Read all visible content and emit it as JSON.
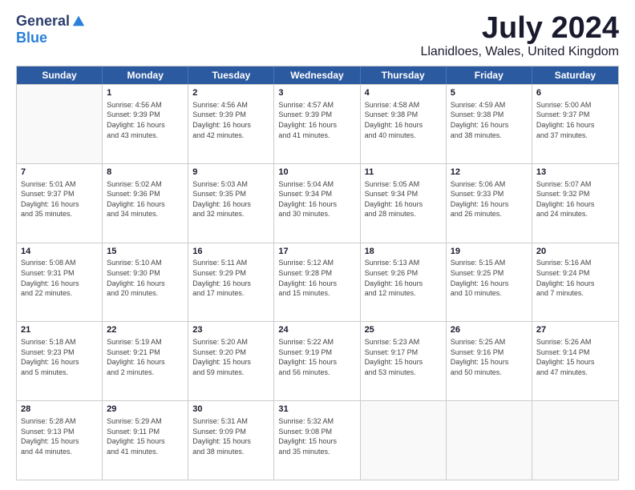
{
  "header": {
    "logo_general": "General",
    "logo_blue": "Blue",
    "month": "July 2024",
    "location": "Llanidloes, Wales, United Kingdom"
  },
  "days_of_week": [
    "Sunday",
    "Monday",
    "Tuesday",
    "Wednesday",
    "Thursday",
    "Friday",
    "Saturday"
  ],
  "rows": [
    [
      {
        "day": "",
        "info": ""
      },
      {
        "day": "1",
        "info": "Sunrise: 4:56 AM\nSunset: 9:39 PM\nDaylight: 16 hours\nand 43 minutes."
      },
      {
        "day": "2",
        "info": "Sunrise: 4:56 AM\nSunset: 9:39 PM\nDaylight: 16 hours\nand 42 minutes."
      },
      {
        "day": "3",
        "info": "Sunrise: 4:57 AM\nSunset: 9:39 PM\nDaylight: 16 hours\nand 41 minutes."
      },
      {
        "day": "4",
        "info": "Sunrise: 4:58 AM\nSunset: 9:38 PM\nDaylight: 16 hours\nand 40 minutes."
      },
      {
        "day": "5",
        "info": "Sunrise: 4:59 AM\nSunset: 9:38 PM\nDaylight: 16 hours\nand 38 minutes."
      },
      {
        "day": "6",
        "info": "Sunrise: 5:00 AM\nSunset: 9:37 PM\nDaylight: 16 hours\nand 37 minutes."
      }
    ],
    [
      {
        "day": "7",
        "info": "Sunrise: 5:01 AM\nSunset: 9:37 PM\nDaylight: 16 hours\nand 35 minutes."
      },
      {
        "day": "8",
        "info": "Sunrise: 5:02 AM\nSunset: 9:36 PM\nDaylight: 16 hours\nand 34 minutes."
      },
      {
        "day": "9",
        "info": "Sunrise: 5:03 AM\nSunset: 9:35 PM\nDaylight: 16 hours\nand 32 minutes."
      },
      {
        "day": "10",
        "info": "Sunrise: 5:04 AM\nSunset: 9:34 PM\nDaylight: 16 hours\nand 30 minutes."
      },
      {
        "day": "11",
        "info": "Sunrise: 5:05 AM\nSunset: 9:34 PM\nDaylight: 16 hours\nand 28 minutes."
      },
      {
        "day": "12",
        "info": "Sunrise: 5:06 AM\nSunset: 9:33 PM\nDaylight: 16 hours\nand 26 minutes."
      },
      {
        "day": "13",
        "info": "Sunrise: 5:07 AM\nSunset: 9:32 PM\nDaylight: 16 hours\nand 24 minutes."
      }
    ],
    [
      {
        "day": "14",
        "info": "Sunrise: 5:08 AM\nSunset: 9:31 PM\nDaylight: 16 hours\nand 22 minutes."
      },
      {
        "day": "15",
        "info": "Sunrise: 5:10 AM\nSunset: 9:30 PM\nDaylight: 16 hours\nand 20 minutes."
      },
      {
        "day": "16",
        "info": "Sunrise: 5:11 AM\nSunset: 9:29 PM\nDaylight: 16 hours\nand 17 minutes."
      },
      {
        "day": "17",
        "info": "Sunrise: 5:12 AM\nSunset: 9:28 PM\nDaylight: 16 hours\nand 15 minutes."
      },
      {
        "day": "18",
        "info": "Sunrise: 5:13 AM\nSunset: 9:26 PM\nDaylight: 16 hours\nand 12 minutes."
      },
      {
        "day": "19",
        "info": "Sunrise: 5:15 AM\nSunset: 9:25 PM\nDaylight: 16 hours\nand 10 minutes."
      },
      {
        "day": "20",
        "info": "Sunrise: 5:16 AM\nSunset: 9:24 PM\nDaylight: 16 hours\nand 7 minutes."
      }
    ],
    [
      {
        "day": "21",
        "info": "Sunrise: 5:18 AM\nSunset: 9:23 PM\nDaylight: 16 hours\nand 5 minutes."
      },
      {
        "day": "22",
        "info": "Sunrise: 5:19 AM\nSunset: 9:21 PM\nDaylight: 16 hours\nand 2 minutes."
      },
      {
        "day": "23",
        "info": "Sunrise: 5:20 AM\nSunset: 9:20 PM\nDaylight: 15 hours\nand 59 minutes."
      },
      {
        "day": "24",
        "info": "Sunrise: 5:22 AM\nSunset: 9:19 PM\nDaylight: 15 hours\nand 56 minutes."
      },
      {
        "day": "25",
        "info": "Sunrise: 5:23 AM\nSunset: 9:17 PM\nDaylight: 15 hours\nand 53 minutes."
      },
      {
        "day": "26",
        "info": "Sunrise: 5:25 AM\nSunset: 9:16 PM\nDaylight: 15 hours\nand 50 minutes."
      },
      {
        "day": "27",
        "info": "Sunrise: 5:26 AM\nSunset: 9:14 PM\nDaylight: 15 hours\nand 47 minutes."
      }
    ],
    [
      {
        "day": "28",
        "info": "Sunrise: 5:28 AM\nSunset: 9:13 PM\nDaylight: 15 hours\nand 44 minutes."
      },
      {
        "day": "29",
        "info": "Sunrise: 5:29 AM\nSunset: 9:11 PM\nDaylight: 15 hours\nand 41 minutes."
      },
      {
        "day": "30",
        "info": "Sunrise: 5:31 AM\nSunset: 9:09 PM\nDaylight: 15 hours\nand 38 minutes."
      },
      {
        "day": "31",
        "info": "Sunrise: 5:32 AM\nSunset: 9:08 PM\nDaylight: 15 hours\nand 35 minutes."
      },
      {
        "day": "",
        "info": ""
      },
      {
        "day": "",
        "info": ""
      },
      {
        "day": "",
        "info": ""
      }
    ]
  ]
}
